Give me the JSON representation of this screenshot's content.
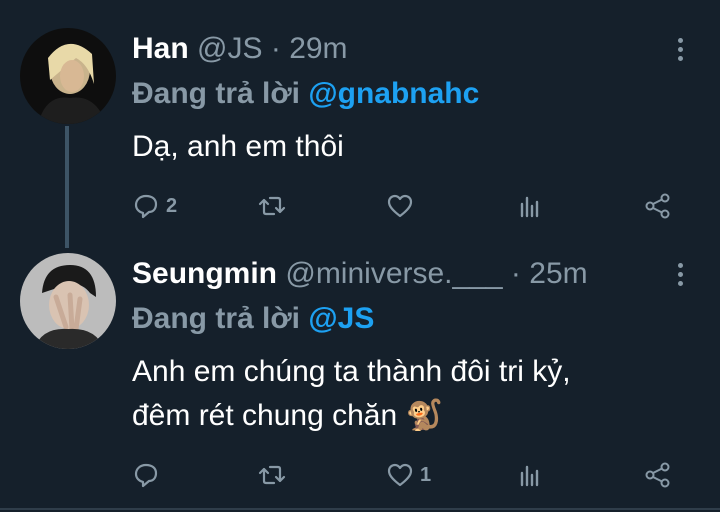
{
  "tweets": [
    {
      "name": "Han",
      "handle": "@JS",
      "dot": "·",
      "time": "29m",
      "replying_prefix": "Đang trả lời",
      "replying_to": "@gnabnahc",
      "text": "Dạ, anh em thôi",
      "reply_count": "2",
      "retweet_count": "",
      "like_count": ""
    },
    {
      "name": "Seungmin",
      "handle": "@miniverse.___",
      "dot": "·",
      "time": "25m",
      "replying_prefix": "Đang trả lời",
      "replying_to": "@JS",
      "text_line1": "Anh em chúng ta thành đôi tri kỷ,",
      "text_line2": "đêm rét chung chăn 🐒",
      "reply_count": "",
      "retweet_count": "",
      "like_count": "1"
    }
  ],
  "icons": {
    "reply": "reply-icon",
    "retweet": "retweet-icon",
    "like": "heart-icon",
    "analytics": "analytics-icon",
    "share": "share-icon",
    "more": "more-vertical-icon"
  },
  "colors": {
    "background": "#15202b",
    "muted": "#8899a6",
    "link": "#1da1f2",
    "thread_line": "#3d5466"
  }
}
